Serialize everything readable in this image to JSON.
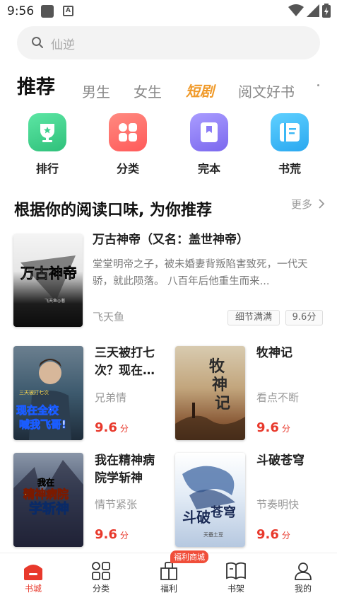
{
  "status_bar": {
    "time": "9:56"
  },
  "search": {
    "placeholder": "仙逆"
  },
  "tabs": [
    {
      "label": "推荐"
    },
    {
      "label": "男生"
    },
    {
      "label": "女生"
    },
    {
      "label": "短剧"
    },
    {
      "label": "阅文好书"
    }
  ],
  "quick_entries": [
    {
      "label": "排行",
      "icon": "trophy-icon",
      "color": "#3ecf8e"
    },
    {
      "label": "分类",
      "icon": "grid-icon",
      "color": "#ff6b6b"
    },
    {
      "label": "完本",
      "icon": "bookmark-icon",
      "color": "#8b7cf6"
    },
    {
      "label": "书荒",
      "icon": "book-icon",
      "color": "#3cb8f5"
    }
  ],
  "section": {
    "title": "根据你的阅读口味, 为你推荐",
    "more": "更多"
  },
  "featured": {
    "title": "万古神帝（又名：盖世神帝）",
    "description": "堂堂明帝之子，被未婚妻背叛陷害致死，一代天骄，就此陨落。 八百年后他重生而来...",
    "author": "飞天鱼",
    "tags": [
      "细节满满",
      "9.6分"
    ]
  },
  "books": [
    {
      "title_line1": "三天被打七",
      "title_line2": "次？现在…",
      "subtitle": "兄弟情",
      "score": "9.6",
      "unit": "分"
    },
    {
      "title_line1": "牧神记",
      "title_line2": "",
      "subtitle": "看点不断",
      "score": "9.6",
      "unit": "分"
    },
    {
      "title_line1": "我在精神病",
      "title_line2": "院学斩神",
      "subtitle": "情节紧张",
      "score": "9.6",
      "unit": "分"
    },
    {
      "title_line1": "斗破苍穹",
      "title_line2": "",
      "subtitle": "节奏明快",
      "score": "9.6",
      "unit": "分"
    }
  ],
  "bottom_nav": [
    {
      "label": "书城",
      "icon": "store-icon",
      "active": true
    },
    {
      "label": "分类",
      "icon": "category-icon"
    },
    {
      "label": "福利",
      "icon": "gift-icon",
      "badge": "福利商城"
    },
    {
      "label": "书架",
      "icon": "bookshelf-icon"
    },
    {
      "label": "我的",
      "icon": "profile-icon"
    }
  ],
  "colors": {
    "accent": "#e8392c",
    "special_tab": "#f09a2a"
  }
}
